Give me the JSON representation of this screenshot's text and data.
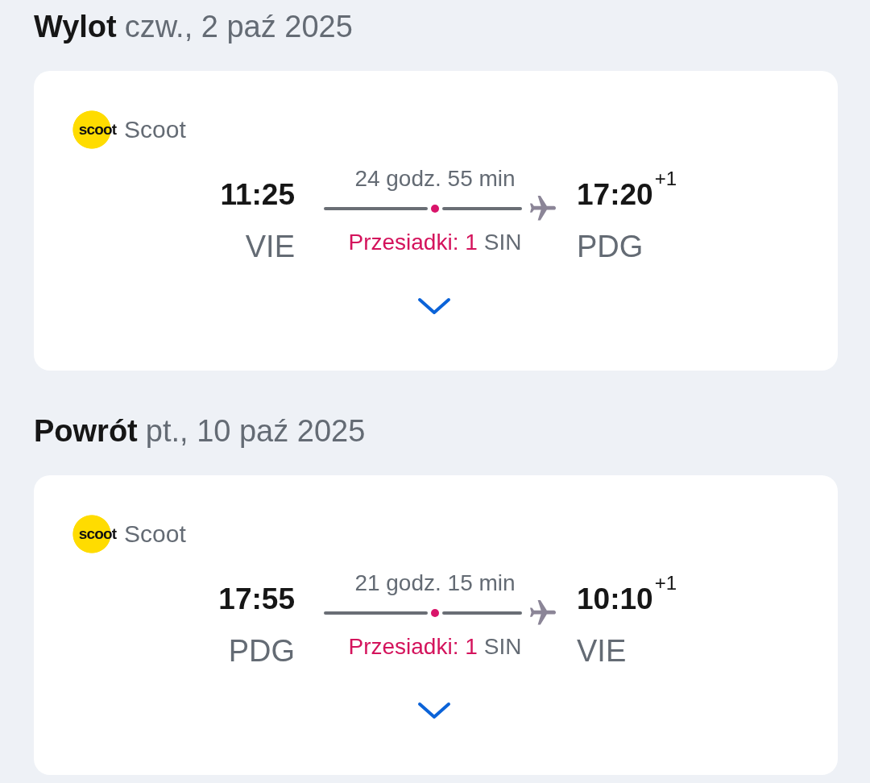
{
  "sections": [
    {
      "label": "Wylot",
      "date": "czw., 2 paź 2025",
      "airline": {
        "logo_text": "scoot",
        "name": "Scoot"
      },
      "departure": {
        "time": "11:25",
        "airport": "VIE"
      },
      "duration": "24 godz. 55 min",
      "stops": {
        "label": "Przesiadki: 1",
        "via": [
          "SIN"
        ]
      },
      "arrival": {
        "time": "17:20",
        "day_offset": "+1",
        "airport": "PDG"
      },
      "expanded": false
    },
    {
      "label": "Powrót",
      "date": "pt., 10 paź 2025",
      "airline": {
        "logo_text": "scoot",
        "name": "Scoot"
      },
      "departure": {
        "time": "17:55",
        "airport": "PDG"
      },
      "duration": "21 godz. 15 min",
      "stops": {
        "label": "Przesiadki: 1",
        "via": [
          "SIN"
        ]
      },
      "arrival": {
        "time": "10:10",
        "day_offset": "+1",
        "airport": "VIE"
      },
      "expanded": false
    }
  ]
}
